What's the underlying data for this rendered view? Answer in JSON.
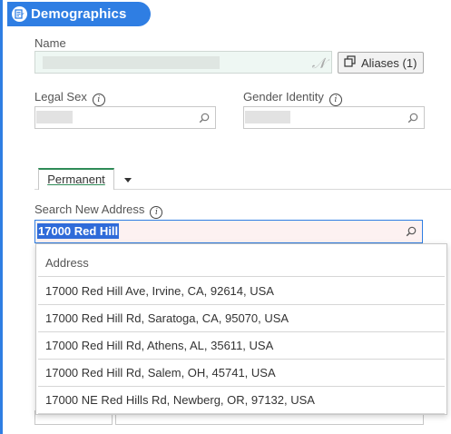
{
  "header": {
    "title": "Demographics",
    "icon": "form-icon"
  },
  "name_section": {
    "label": "Name",
    "aliases_button": "Aliases (1)"
  },
  "legal_sex": {
    "label": "Legal Sex"
  },
  "gender_identity": {
    "label": "Gender Identity"
  },
  "tabs": [
    {
      "label": "Permanent"
    }
  ],
  "address_search": {
    "label": "Search New Address",
    "value": "17000 Red Hill"
  },
  "address_dropdown": {
    "header": "Address",
    "items": [
      "17000 Red Hill Ave, Irvine, CA, 92614, USA",
      "17000 Red Hill Rd, Saratoga, CA, 95070, USA",
      "17000 Red Hill Rd, Athens, AL, 35611, USA",
      "17000 Red Hill Rd, Salem, OH, 45741, USA",
      "17000 NE Red Hills Rd, Newberg, OR, 97132, USA"
    ]
  },
  "colors": {
    "accent": "#2f7ee3",
    "tab_accent": "#2e8b57",
    "selection": "#2f6bd9"
  }
}
